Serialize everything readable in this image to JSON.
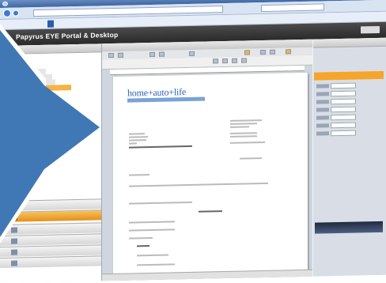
{
  "app": {
    "title": "Papyrus EYE Portal & Desktop"
  },
  "colors": {
    "accent_orange": "#f6a52b",
    "arrow_blue": "#3f78b4",
    "header_dark": "#2f2f2f",
    "logo_blue": "#2e63b5"
  },
  "document": {
    "logo": "home+auto+life"
  },
  "icons": [
    "ie-icon",
    "back-arrow-icon",
    "forward-arrow-icon",
    "minimize-icon",
    "maximize-icon",
    "close-icon"
  ]
}
